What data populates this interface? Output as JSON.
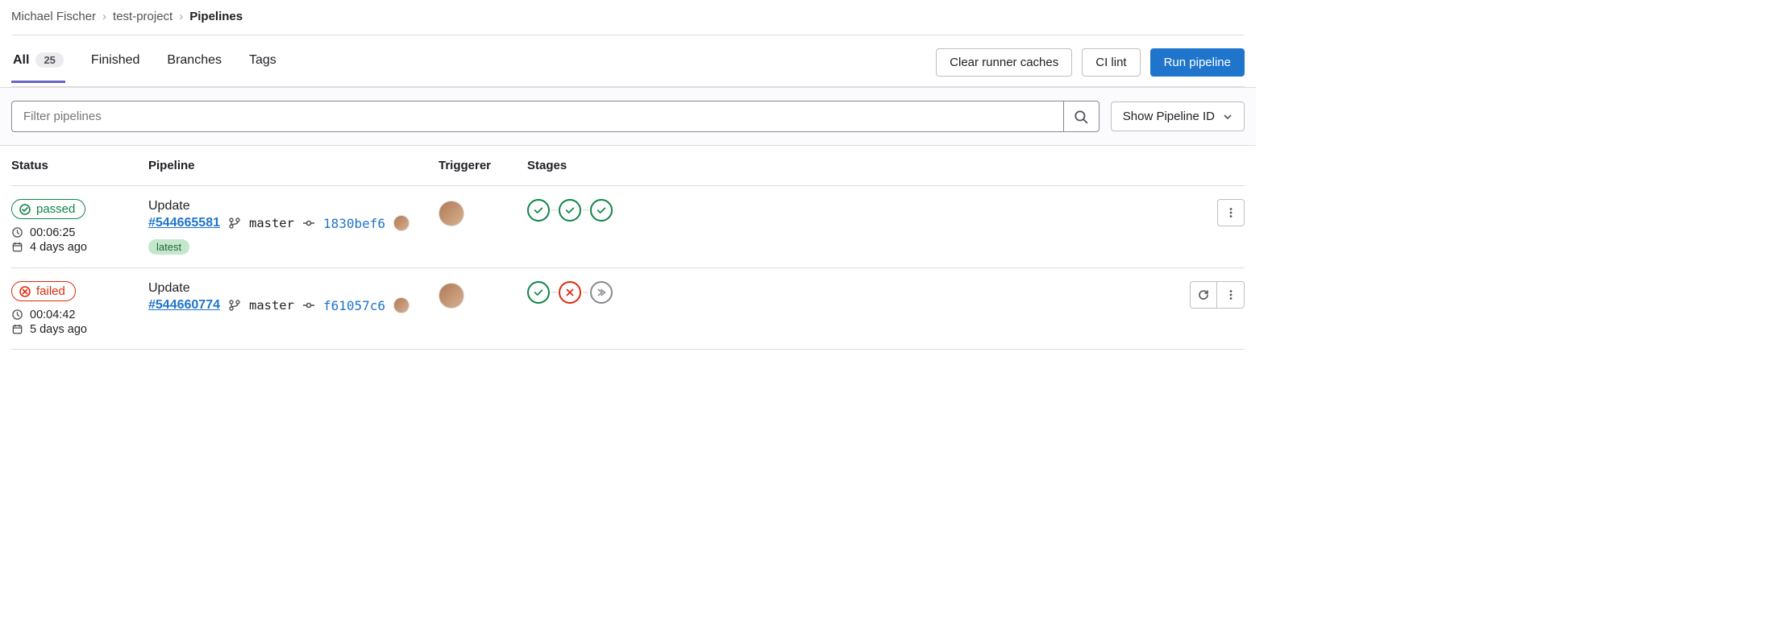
{
  "breadcrumb": {
    "user": "Michael Fischer",
    "project": "test-project",
    "page": "Pipelines"
  },
  "tabs": {
    "all": {
      "label": "All",
      "count": "25"
    },
    "finished": {
      "label": "Finished"
    },
    "branches": {
      "label": "Branches"
    },
    "tags": {
      "label": "Tags"
    }
  },
  "actions": {
    "clear_caches": "Clear runner caches",
    "ci_lint": "CI lint",
    "run_pipeline": "Run pipeline"
  },
  "filter": {
    "placeholder": "Filter pipelines",
    "show_dropdown": "Show Pipeline ID"
  },
  "columns": {
    "status": "Status",
    "pipeline": "Pipeline",
    "triggerer": "Triggerer",
    "stages": "Stages"
  },
  "rows": [
    {
      "status": "passed",
      "duration": "00:06:25",
      "finished": "4 days ago",
      "title": "Update",
      "pipeline_id": "#544665581",
      "branch": "master",
      "commit": "1830bef6",
      "labels": [
        "latest"
      ],
      "stages": [
        "passed",
        "passed",
        "passed"
      ],
      "retry": false
    },
    {
      "status": "failed",
      "duration": "00:04:42",
      "finished": "5 days ago",
      "title": "Update",
      "pipeline_id": "#544660774",
      "branch": "master",
      "commit": "f61057c6",
      "labels": [],
      "stages": [
        "passed",
        "failed",
        "skipped"
      ],
      "retry": true
    }
  ]
}
